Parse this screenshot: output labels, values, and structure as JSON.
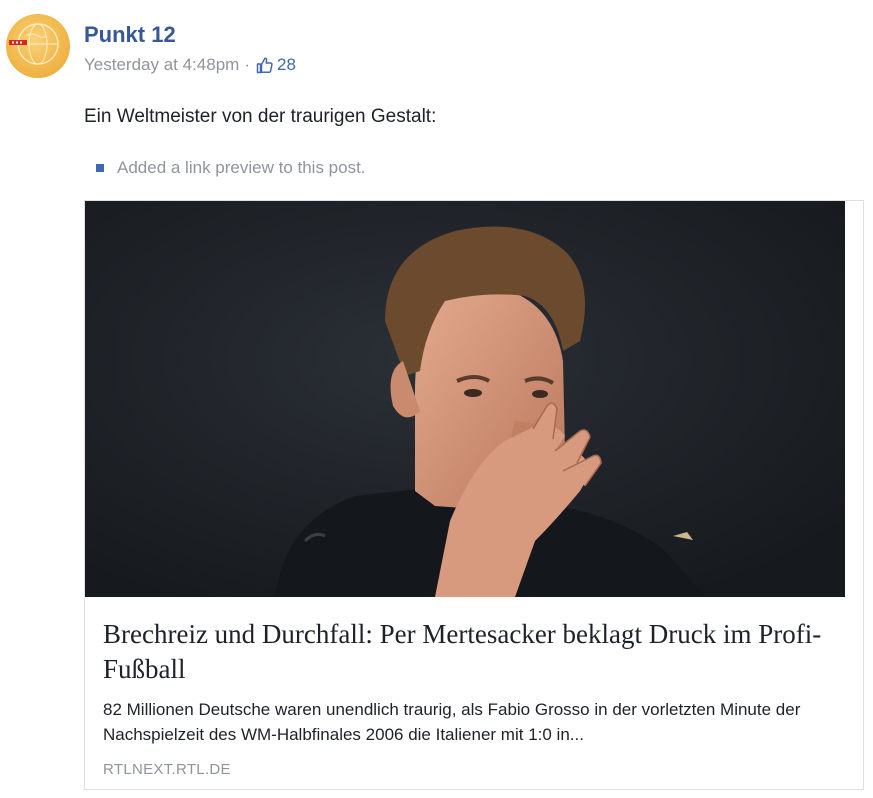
{
  "post": {
    "author": "Punkt 12",
    "timestamp": "Yesterday at 4:48pm",
    "separator": "·",
    "like_count": "28",
    "text": "Ein Weltmeister von der traurigen Gestalt:",
    "edit_note": "Added a link preview to this post."
  },
  "link_preview": {
    "title": "Brechreiz und Durchfall: Per Mertesacker beklagt Druck im Profi-Fußball",
    "description": "82 Millionen Deutsche waren unendlich traurig, als Fabio Grosso in der vorletzten Minute der Nachspielzeit des WM-Halbfinales 2006 die Italiener mit 1:0 in...",
    "domain": "RTLNEXT.RTL.DE"
  },
  "icons": {
    "avatar": "globe-logo-icon",
    "likes": "thumbs-up-icon",
    "edit_note": "square-bullet-icon"
  },
  "colors": {
    "link_blue": "#365899",
    "accent_blue": "#4267b2",
    "meta_gray": "#90949c",
    "text": "#1d2129",
    "card_border": "#dddfe2"
  }
}
